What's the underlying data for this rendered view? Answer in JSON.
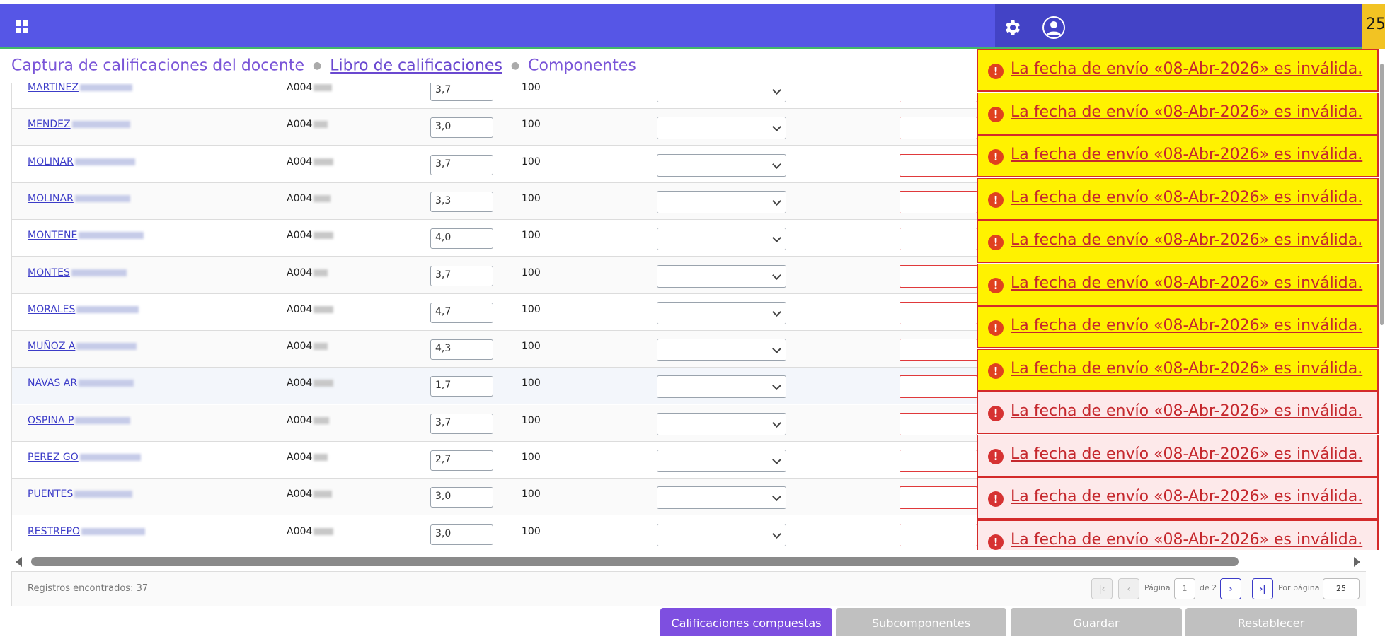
{
  "topbar": {
    "apps_icon": "apps-grid-icon",
    "settings_icon": "gear-icon",
    "user_icon": "user-avatar-icon",
    "badge_text": "25",
    "colors": {
      "bar": "#5656e6",
      "bar_dark": "#4343c6",
      "accent_line": "#44b86a",
      "badge": "#f2c323"
    }
  },
  "breadcrumb": {
    "items": [
      "Captura de calificaciones del docente",
      "Libro de calificaciones",
      "Componentes"
    ]
  },
  "table": {
    "rows": [
      {
        "name": "MARTINEZ",
        "id": "A004",
        "grade": "3,7",
        "max": "100"
      },
      {
        "name": "MENDEZ",
        "id": "A004",
        "grade": "3,0",
        "max": "100"
      },
      {
        "name": "MOLINAR",
        "id": "A004",
        "grade": "3,7",
        "max": "100"
      },
      {
        "name": "MOLINAR",
        "id": "A004",
        "grade": "3,3",
        "max": "100"
      },
      {
        "name": "MONTENE",
        "id": "A004",
        "grade": "4,0",
        "max": "100"
      },
      {
        "name": "MONTES",
        "id": "A004",
        "grade": "3,7",
        "max": "100"
      },
      {
        "name": "MORALES",
        "id": "A004",
        "grade": "4,7",
        "max": "100"
      },
      {
        "name": "MUÑOZ A",
        "id": "A004",
        "grade": "4,3",
        "max": "100"
      },
      {
        "name": "NAVAS AR",
        "id": "A004",
        "grade": "1,7",
        "max": "100"
      },
      {
        "name": "OSPINA P",
        "id": "A004",
        "grade": "3,7",
        "max": "100"
      },
      {
        "name": "PEREZ GO",
        "id": "A004",
        "grade": "2,7",
        "max": "100"
      },
      {
        "name": "PUENTES",
        "id": "A004",
        "grade": "3,0",
        "max": "100"
      },
      {
        "name": "RESTREPO",
        "id": "A004",
        "grade": "3,0",
        "max": "100"
      }
    ]
  },
  "footer": {
    "records_label": "Registros encontrados: 37",
    "page_label": "Página",
    "page_value": "1",
    "page_of": "de 2",
    "per_page_label": "Por página",
    "per_page_value": "25"
  },
  "actions": {
    "composite": "Calificaciones compuestas",
    "subcomponents": "Subcomponentes",
    "save": "Guardar",
    "reset": "Restablecer"
  },
  "notifications": {
    "message": "La fecha de envío «08-Abr-2026» es inválida.",
    "items": [
      {
        "style": "warning"
      },
      {
        "style": "warning"
      },
      {
        "style": "warning"
      },
      {
        "style": "warning"
      },
      {
        "style": "warning"
      },
      {
        "style": "warning"
      },
      {
        "style": "warning"
      },
      {
        "style": "warning"
      },
      {
        "style": "error"
      },
      {
        "style": "error"
      },
      {
        "style": "error"
      },
      {
        "style": "error"
      }
    ],
    "icon": "exclamation-circle-icon",
    "colors": {
      "warning_bg": "#fff200",
      "error_bg": "#fde9ea",
      "text": "#c5282d"
    }
  }
}
